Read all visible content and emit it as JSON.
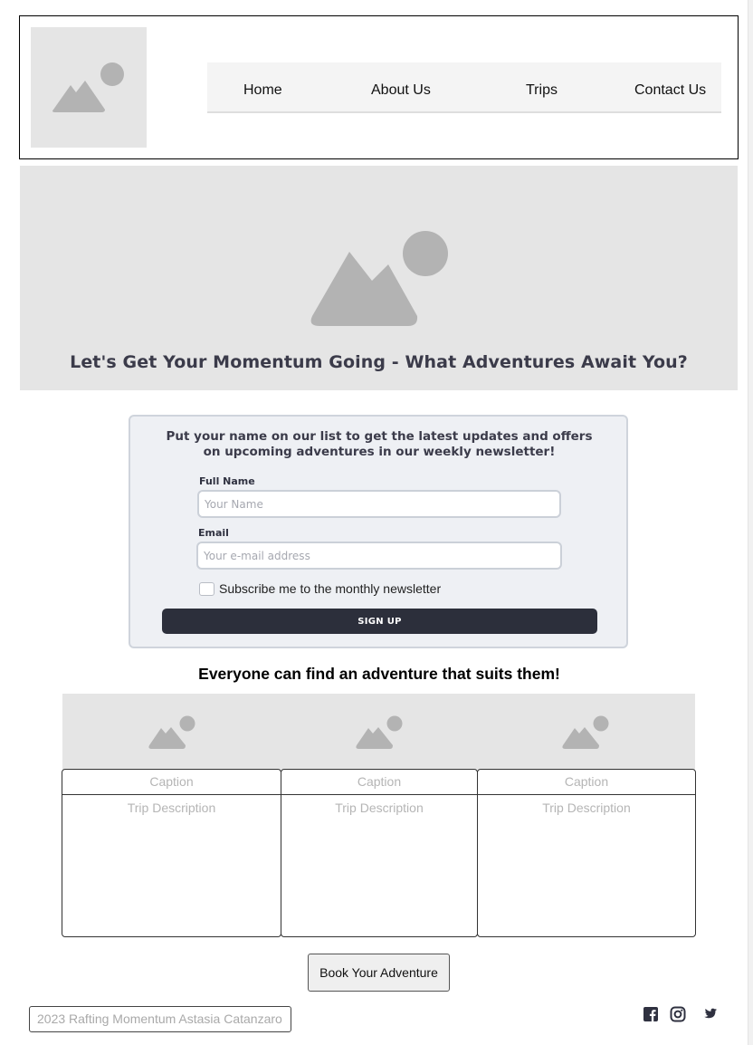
{
  "header": {
    "logo_icon": "image-placeholder-icon",
    "nav": [
      "Home",
      "About Us",
      "Trips",
      "Contact Us"
    ]
  },
  "hero": {
    "image_icon": "image-placeholder-icon",
    "title": "Let's Get Your Momentum Going - What Adventures Await You?"
  },
  "newsletter": {
    "intro": "Put your name on our list to get the latest updates and offers on upcoming adventures in our weekly newsletter!",
    "name_label": "Full Name",
    "name_placeholder": "Your Name",
    "email_label": "Email",
    "email_placeholder": "Your e-mail address",
    "checkbox_label": "Subscribe me to the monthly newsletter",
    "checkbox_checked": false,
    "button": "SIGN UP"
  },
  "trips": {
    "title": "Everyone can find an adventure that suits them!",
    "cards": [
      {
        "image_icon": "image-placeholder-icon",
        "caption": "Caption",
        "description": "Trip Description"
      },
      {
        "image_icon": "image-placeholder-icon",
        "caption": "Caption",
        "description": "Trip Description"
      },
      {
        "image_icon": "image-placeholder-icon",
        "caption": "Caption",
        "description": "Trip Description"
      }
    ],
    "book_button": "Book Your Adventure"
  },
  "footer": {
    "copyright": "2023 Rafting Momentum Astasia Catanzaro",
    "social_icons": [
      "facebook-icon",
      "instagram-icon",
      "twitter-icon"
    ]
  },
  "colors": {
    "placeholder_bg": "#e5e5e5",
    "placeholder_glyph": "#b3b3b3",
    "heading_text": "#3b3b4a",
    "form_bg": "#eef0f4",
    "button_dark": "#2c2f3b"
  }
}
